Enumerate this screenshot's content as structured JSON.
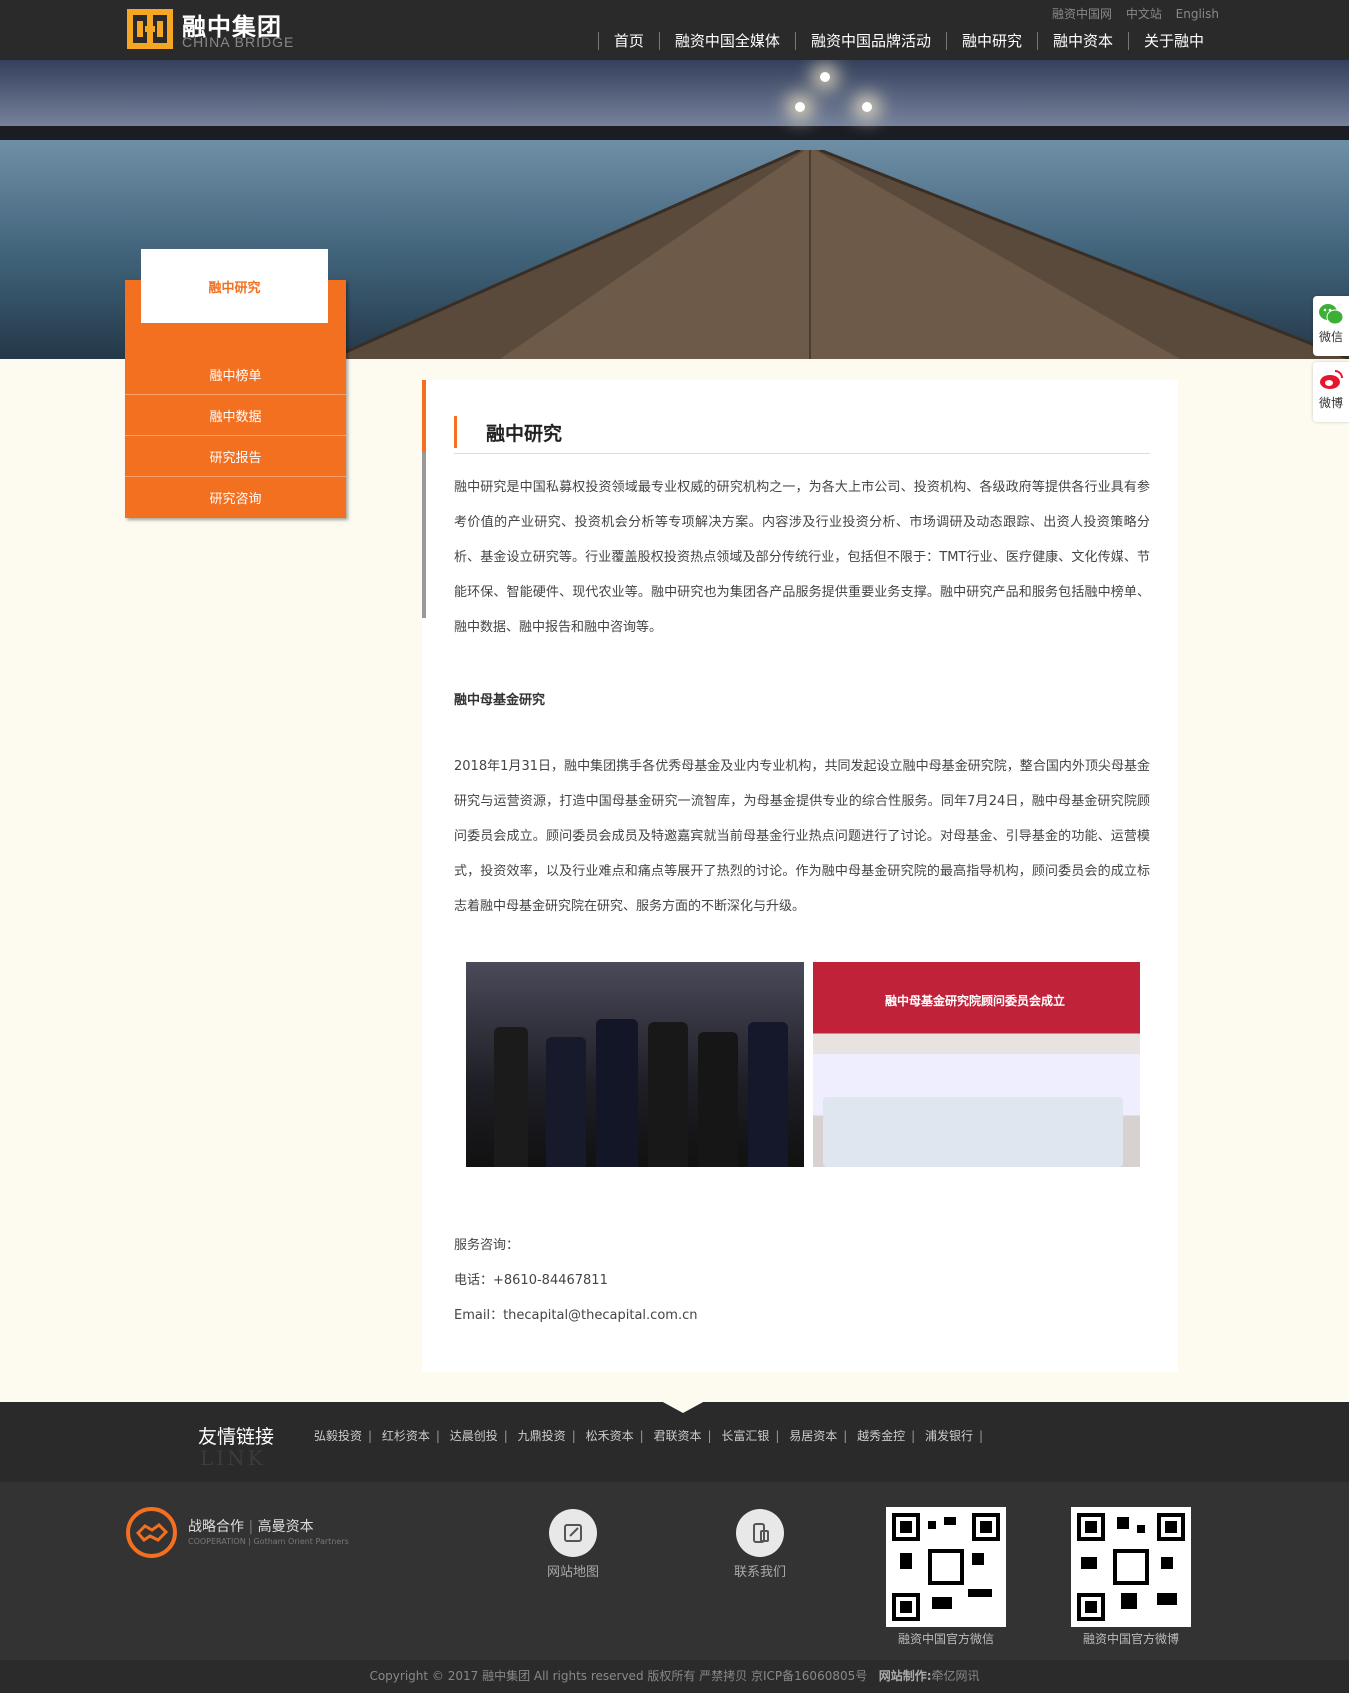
{
  "header": {
    "logo_cn": "融中集团",
    "logo_en": "CHINA BRIDGE",
    "toplinks": [
      "融资中国网",
      "中文站",
      "English"
    ],
    "nav": [
      "首页",
      "融资中国全媒体",
      "融资中国品牌活动",
      "融中研究",
      "融中资本",
      "关于融中"
    ]
  },
  "side": {
    "title": "融中研究",
    "items": [
      "融中榜单",
      "融中数据",
      "研究报告",
      "研究咨询"
    ]
  },
  "float": {
    "wechat": "微信",
    "weibo": "微博"
  },
  "content": {
    "title": "融中研究",
    "intro": "融中研究是中国私募权投资领域最专业权威的研究机构之一，为各大上市公司、投资机构、各级政府等提供各行业具有参考价值的产业研究、投资机会分析等专项解决方案。内容涉及行业投资分析、市场调研及动态跟踪、出资人投资策略分析、基金设立研究等。行业覆盖股权投资热点领域及部分传统行业，包括但不限于：TMT行业、医疗健康、文化传媒、节能环保、智能硬件、现代农业等。融中研究也为集团各产品服务提供重要业务支撑。融中研究产品和服务包括融中榜单、融中数据、融中报告和融中咨询等。",
    "subhead": "融中母基金研究",
    "body": "2018年1月31日，融中集团携手各优秀母基金及业内专业机构，共同发起设立融中母基金研究院，整合国内外顶尖母基金研究与运营资源，打造中国母基金研究一流智库，为母基金提供专业的综合性服务。同年7月24日，融中母基金研究院顾问委员会成立。顾问委员会成员及特邀嘉宾就当前母基金行业热点问题进行了讨论。对母基金、引导基金的功能、运营模式，投资效率，以及行业难点和痛点等展开了热烈的讨论。作为融中母基金研究院的最高指导机构，顾问委员会的成立标志着融中母基金研究院在研究、服务方面的不断深化与升级。",
    "photo_banner": "融中母基金研究院顾问委员会成立",
    "contact_label": "服务咨询：",
    "phone": "电话：+8610-84467811",
    "email": "Email：thecapital@thecapital.com.cn"
  },
  "links": {
    "title": "友情链接",
    "sub": "LINK",
    "items": [
      "弘毅投资",
      "红杉资本",
      "达晨创投",
      "九鼎投资",
      "松禾资本",
      "君联资本",
      "长富汇银",
      "易居资本",
      "越秀金控",
      "浦发银行"
    ]
  },
  "footer": {
    "coop_a": "战略合作",
    "coop_b": "高曼资本",
    "coop_sub_a": "COOPERATION",
    "coop_sub_b": "Gotham Orient Partners",
    "sitemap": "网站地图",
    "contact": "联系我们",
    "qr1": "融资中国官方微信",
    "qr2": "融资中国官方微博",
    "copyright": "Copyright © 2017 融中集团 All rights reserved 版权所有 严禁拷贝 京ICP备16060805号",
    "made_by_label": "网站制作:",
    "made_by": "牵亿网讯"
  },
  "colors": {
    "accent": "#f37021",
    "header_bg": "#2a2a2a",
    "page_bg": "#fdfbf0"
  }
}
